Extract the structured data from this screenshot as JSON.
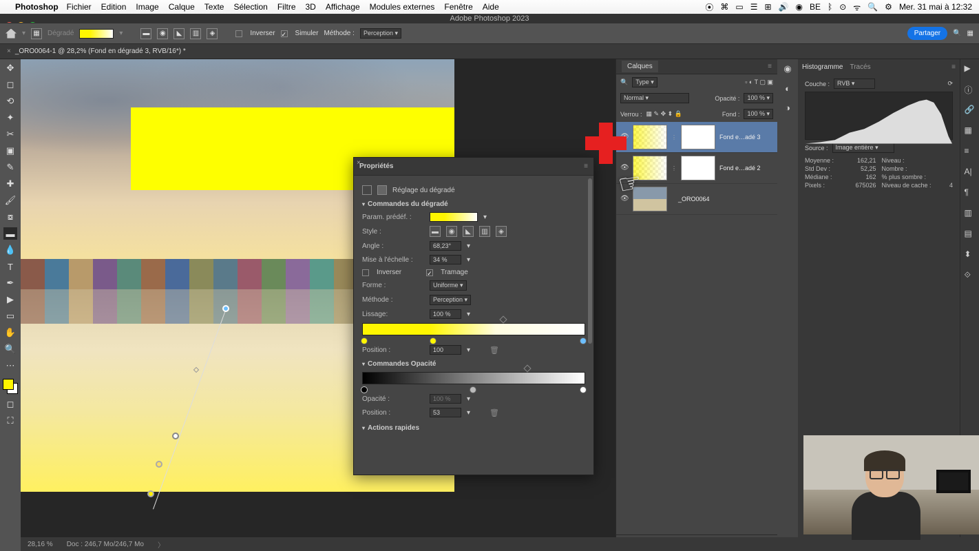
{
  "menubar": {
    "app": "Photoshop",
    "items": [
      "Fichier",
      "Edition",
      "Image",
      "Calque",
      "Texte",
      "Sélection",
      "Filtre",
      "3D",
      "Affichage",
      "Modules externes",
      "Fenêtre",
      "Aide"
    ],
    "clock": "Mer. 31 mai à 12:32"
  },
  "window_title": "Adobe Photoshop 2023",
  "optbar": {
    "tool": "Dégradé",
    "inverser": "Inverser",
    "simuler": "Simuler",
    "methode_lbl": "Méthode :",
    "methode": "Perception",
    "share": "Partager"
  },
  "doc_tab": "_ORO0064-1 @ 28,2% (Fond en dégradé 3, RVB/16*) *",
  "statusbar": {
    "zoom": "28,16 %",
    "doc": "Doc : 246,7 Mo/246,7 Mo"
  },
  "layers": {
    "title": "Calques",
    "kind_label": "Type",
    "mode": "Normal",
    "opacity_lbl": "Opacité :",
    "opacity": "100 %",
    "lock_lbl": "Verrou :",
    "fill_lbl": "Fond :",
    "fill": "100 %",
    "items": [
      {
        "name": "Fond e…adé 3"
      },
      {
        "name": "Fond e…adé 2"
      },
      {
        "name": "_ORO0064"
      }
    ]
  },
  "props": {
    "title": "Propriétés",
    "adj": "Réglage du dégradé",
    "sec_cmd": "Commandes du dégradé",
    "preset_lbl": "Param. prédéf. :",
    "style_lbl": "Style :",
    "angle_lbl": "Angle :",
    "angle": "68,23°",
    "scale_lbl": "Mise à l'échelle :",
    "scale": "34 %",
    "inverser": "Inverser",
    "tramage": "Tramage",
    "forme_lbl": "Forme :",
    "forme": "Uniforme",
    "methode_lbl": "Méthode :",
    "methode": "Perception",
    "lissage_lbl": "Lissage:",
    "lissage": "100 %",
    "position_lbl": "Position :",
    "position": "100",
    "sec_op": "Commandes Opacité",
    "opacite_lbl": "Opacité :",
    "opacite": "100 %",
    "position2": "53",
    "sec_actions": "Actions rapides"
  },
  "histo": {
    "tab1": "Histogramme",
    "tab2": "Tracés",
    "couche_lbl": "Couche :",
    "couche": "RVB",
    "source_lbl": "Source :",
    "source": "Image entière",
    "stats": {
      "moyenne_l": "Moyenne :",
      "moyenne": "162,21",
      "stddev_l": "Std Dev :",
      "stddev": "52,25",
      "mediane_l": "Médiane :",
      "mediane": "162",
      "pixels_l": "Pixels :",
      "pixels": "675026",
      "niveau_l": "Niveau :",
      "niveau": "",
      "nombre_l": "Nombre :",
      "nombre": "",
      "plus_l": "% plus sombre :",
      "plus": "",
      "cache_l": "Niveau de cache :",
      "cache": "4"
    }
  },
  "house_colors": [
    "#8a5a4a",
    "#4a7a9a",
    "#b89a6a",
    "#7a5a8a",
    "#5a8a7a",
    "#9a6a4a",
    "#4a6a9a",
    "#8a8a5a",
    "#5a7a8a",
    "#9a5a6a",
    "#6a8a5a",
    "#8a6a9a",
    "#5a9a8a",
    "#9a8a5a",
    "#6a5a9a",
    "#8a9a6a",
    "#5a6a9a",
    "#9a7a5a"
  ]
}
